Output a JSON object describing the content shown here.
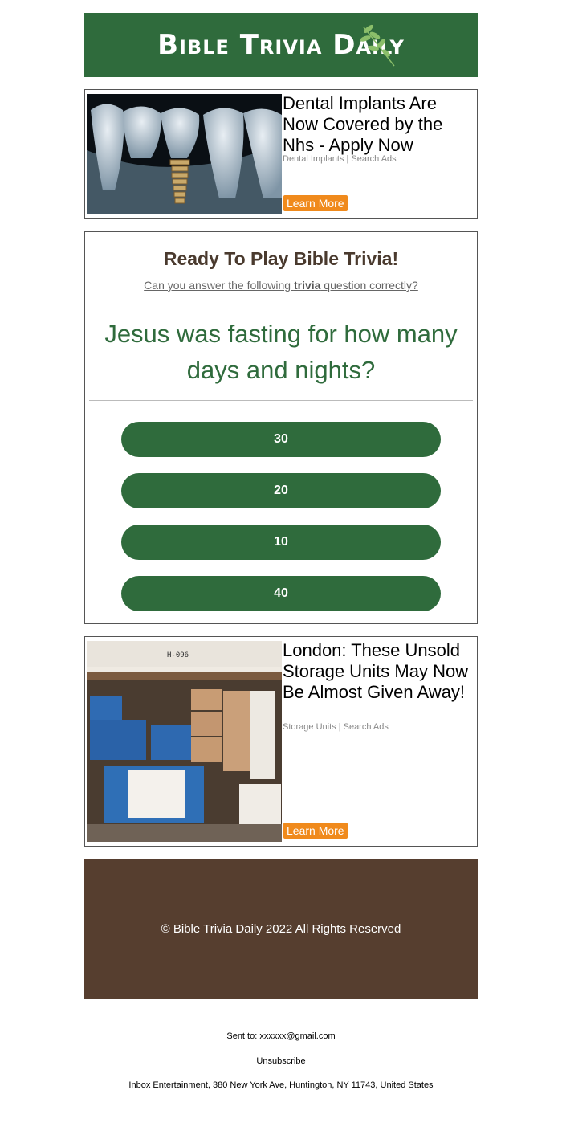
{
  "header": {
    "logo_text": "Bible Trivia Daily",
    "bg_color": "#2f6b3c"
  },
  "ads": [
    {
      "title": "Dental Implants Are Now Covered by the Nhs - Apply Now",
      "meta": "Dental Implants | Search Ads",
      "button": "Learn More",
      "image": "dental-implant-illustration"
    },
    {
      "title": "London: These Unsold Storage Units May Now Be Almost Given Away!",
      "meta": "Storage Units | Search Ads",
      "button": "Learn More",
      "image": "storage-unit-photo",
      "unit_label": "H-096"
    }
  ],
  "trivia": {
    "heading": "Ready To Play Bible Trivia!",
    "sub_prefix": "Can you answer the following ",
    "sub_bold": "trivia",
    "sub_suffix": " question correctly?",
    "question": "Jesus was fasting for how many days and nights?",
    "answers": [
      "30",
      "20",
      "10",
      "40"
    ]
  },
  "footer": {
    "copyright": "© Bible Trivia Daily 2022 All Rights Reserved",
    "bg_color": "#563e2f"
  },
  "bottom": {
    "sent_to": "Sent to: xxxxxx@gmail.com",
    "unsubscribe": "Unsubscribe",
    "address": "Inbox Entertainment, 380 New York Ave, Huntington, NY 11743, United States"
  },
  "colors": {
    "accent_green": "#2f6b3c",
    "button_orange": "#f08a1c",
    "heading_brown": "#4a3a2e"
  }
}
